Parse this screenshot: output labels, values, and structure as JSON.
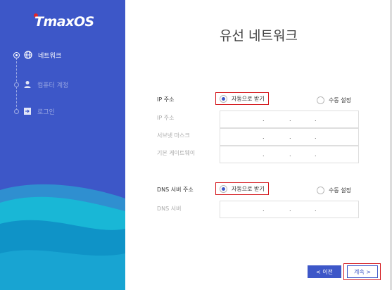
{
  "brand": {
    "logo_text": "TmaxOS",
    "logo_dot_color": "#e0262b"
  },
  "colors": {
    "sidebar": "#3d57c8",
    "accent": "#3d57c8",
    "highlight": "#d4181d",
    "wave_light": "#19b7d6",
    "wave_dark": "#0f93c7"
  },
  "sidebar": {
    "steps": [
      {
        "label": "네트워크",
        "icon": "globe-icon",
        "state": "active"
      },
      {
        "label": "컴퓨터 계정",
        "icon": "user-icon",
        "state": "inactive"
      },
      {
        "label": "로그인",
        "icon": "login-icon",
        "state": "inactive"
      }
    ]
  },
  "main": {
    "title": "유선 네트워크",
    "ip": {
      "section_label": "IP 주소",
      "auto_label": "자동으로 받기",
      "manual_label": "수동 설정",
      "selected": "auto",
      "fields": [
        {
          "label": "IP 주소",
          "separators": [
            ".",
            ".",
            "."
          ]
        },
        {
          "label": "서브넷 마스크",
          "separators": [
            ".",
            ".",
            "."
          ]
        },
        {
          "label": "기본 게이트웨이",
          "separators": [
            ".",
            ".",
            "."
          ]
        }
      ]
    },
    "dns": {
      "section_label": "DNS 서버 주소",
      "auto_label": "자동으로 받기",
      "manual_label": "수동 설정",
      "selected": "auto",
      "fields": [
        {
          "label": "DNS 서버",
          "separators": [
            ".",
            ".",
            "."
          ]
        }
      ]
    },
    "buttons": {
      "prev_label": "< 이전",
      "next_label": "계속 >"
    }
  }
}
